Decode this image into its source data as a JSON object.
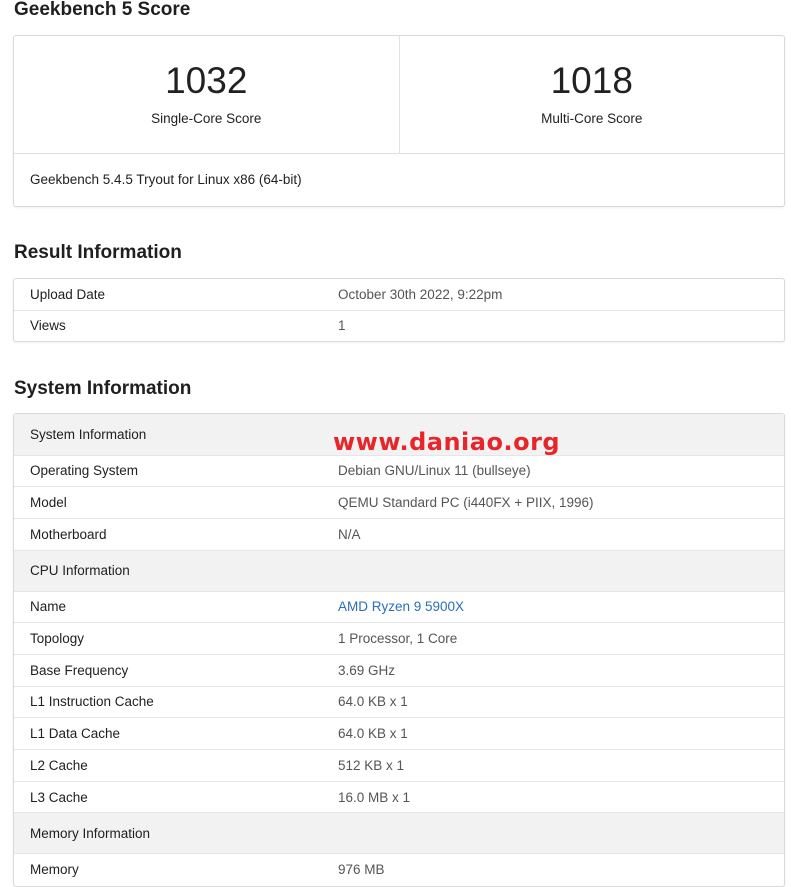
{
  "score_section": {
    "title": "Geekbench 5 Score",
    "single_core": {
      "value": "1032",
      "label": "Single-Core Score"
    },
    "multi_core": {
      "value": "1018",
      "label": "Multi-Core Score"
    },
    "version": "Geekbench 5.4.5 Tryout for Linux x86 (64-bit)"
  },
  "result_section": {
    "title": "Result Information",
    "rows": [
      {
        "name": "Upload Date",
        "value": "October 30th 2022, 9:22pm"
      },
      {
        "name": "Views",
        "value": "1"
      }
    ]
  },
  "system_section": {
    "title": "System Information",
    "system_header": "System Information",
    "system_rows": [
      {
        "name": "Operating System",
        "value": "Debian GNU/Linux 11 (bullseye)"
      },
      {
        "name": "Model",
        "value": "QEMU Standard PC (i440FX + PIIX, 1996)"
      },
      {
        "name": "Motherboard",
        "value": "N/A"
      }
    ],
    "cpu_header": "CPU Information",
    "cpu_rows": [
      {
        "name": "Name",
        "value": "AMD Ryzen 9 5900X"
      },
      {
        "name": "Topology",
        "value": "1 Processor, 1 Core"
      },
      {
        "name": "Base Frequency",
        "value": "3.69 GHz"
      },
      {
        "name": "L1 Instruction Cache",
        "value": "64.0 KB x 1"
      },
      {
        "name": "L1 Data Cache",
        "value": "64.0 KB x 1"
      },
      {
        "name": "L2 Cache",
        "value": "512 KB x 1"
      },
      {
        "name": "L3 Cache",
        "value": "16.0 MB x 1"
      }
    ],
    "memory_header": "Memory Information",
    "memory_rows": [
      {
        "name": "Memory",
        "value": "976 MB"
      }
    ]
  },
  "watermark": "www.daniao.org",
  "colors": {
    "link": "#2a6fb5",
    "watermark": "#e8262a",
    "section_bg": "#f2f2f2"
  }
}
